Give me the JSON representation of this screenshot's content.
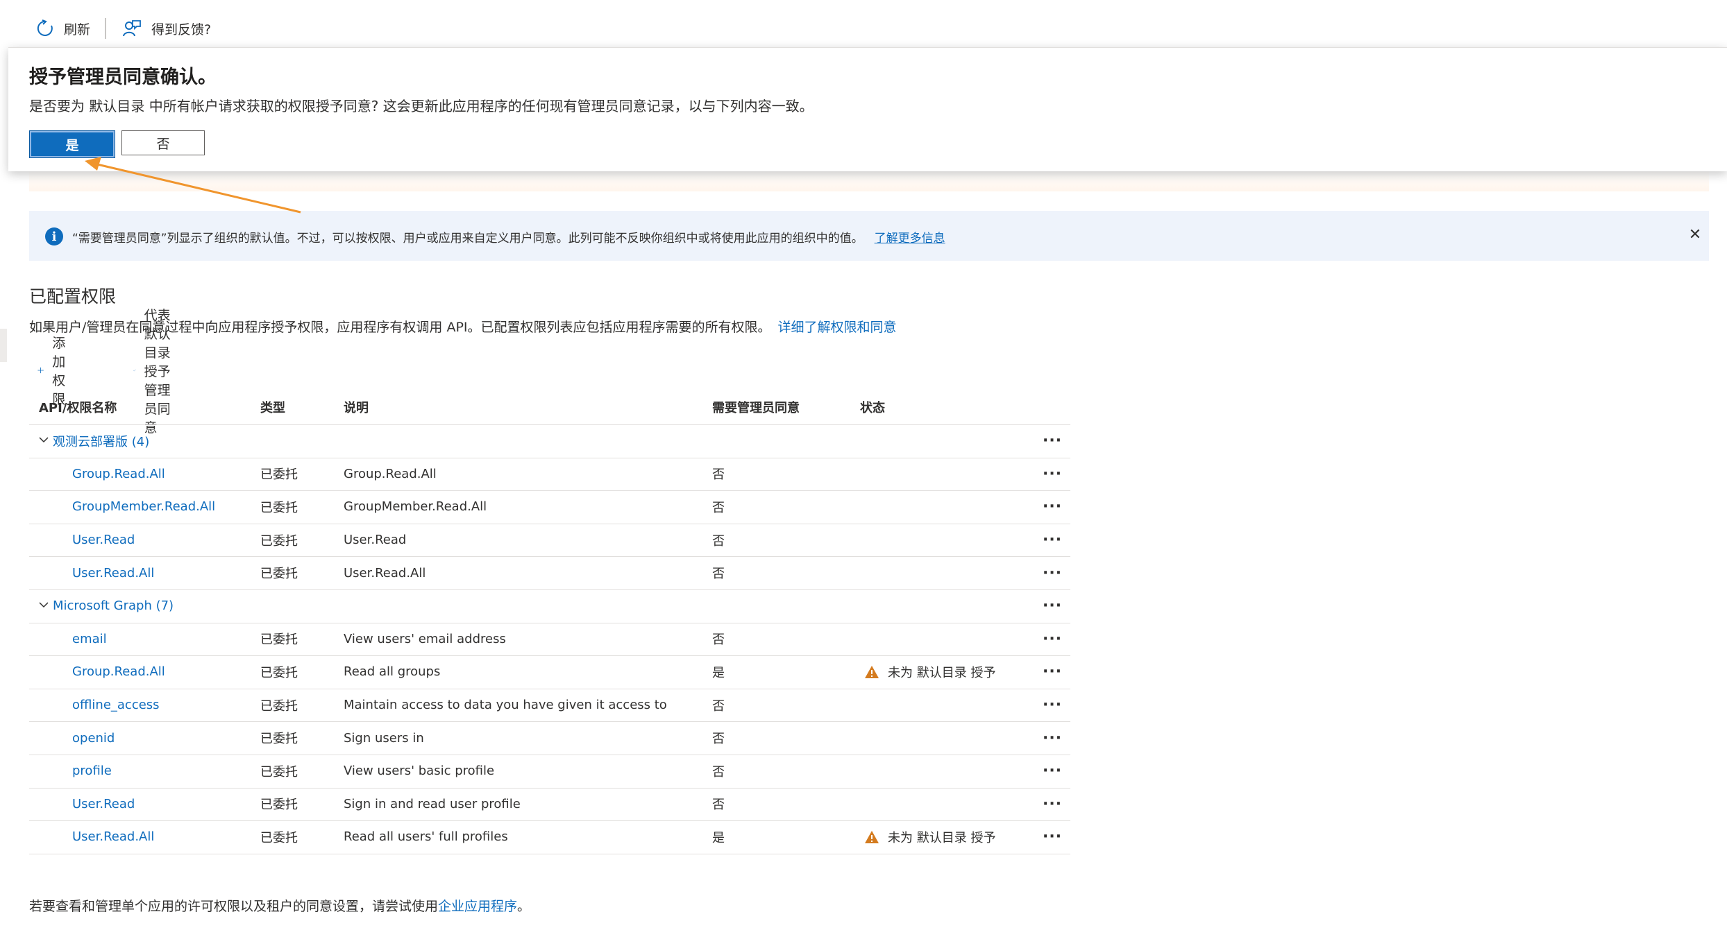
{
  "toolbar": {
    "refresh_label": "刷新",
    "feedback_label": "得到反馈?"
  },
  "dialog": {
    "title": "授予管理员同意确认。",
    "message": "是否要为 默认目录 中所有帐户请求获取的权限授予同意? 这会更新此应用程序的任何现有管理员同意记录，以与下列内容一致。",
    "yes_label": "是",
    "no_label": "否"
  },
  "info_banner": {
    "text": "“需要管理员同意”列显示了组织的默认值。不过，可以按权限、用户或应用来自定义用户同意。此列可能不反映你组织中或将使用此应用的组织中的值。",
    "link": "了解更多信息"
  },
  "section": {
    "title": "已配置权限",
    "description": "如果用户/管理员在同意过程中向应用程序授予权限，应用程序有权调用 API。已配置权限列表应包括应用程序需要的所有权限。",
    "link": "详细了解权限和同意"
  },
  "actions": {
    "add_permission": "添加权限",
    "grant_consent": "代表 默认目录 授予管理员同意"
  },
  "table": {
    "headers": {
      "name": "API/权限名称",
      "type": "类型",
      "description": "说明",
      "admin_consent": "需要管理员同意",
      "status": "状态"
    },
    "more_glyph": "···",
    "groups": [
      {
        "label": "观测云部署版 (4)",
        "rows": [
          {
            "name": "Group.Read.All",
            "type": "已委托",
            "description": "Group.Read.All",
            "admin": "否",
            "status": ""
          },
          {
            "name": "GroupMember.Read.All",
            "type": "已委托",
            "description": "GroupMember.Read.All",
            "admin": "否",
            "status": ""
          },
          {
            "name": "User.Read",
            "type": "已委托",
            "description": "User.Read",
            "admin": "否",
            "status": ""
          },
          {
            "name": "User.Read.All",
            "type": "已委托",
            "description": "User.Read.All",
            "admin": "否",
            "status": ""
          }
        ]
      },
      {
        "label": "Microsoft Graph (7)",
        "rows": [
          {
            "name": "email",
            "type": "已委托",
            "description": "View users' email address",
            "admin": "否",
            "status": ""
          },
          {
            "name": "Group.Read.All",
            "type": "已委托",
            "description": "Read all groups",
            "admin": "是",
            "status": "未为 默认目录 授予"
          },
          {
            "name": "offline_access",
            "type": "已委托",
            "description": "Maintain access to data you have given it access to",
            "admin": "否",
            "status": ""
          },
          {
            "name": "openid",
            "type": "已委托",
            "description": "Sign users in",
            "admin": "否",
            "status": ""
          },
          {
            "name": "profile",
            "type": "已委托",
            "description": "View users' basic profile",
            "admin": "否",
            "status": ""
          },
          {
            "name": "User.Read",
            "type": "已委托",
            "description": "Sign in and read user profile",
            "admin": "否",
            "status": ""
          },
          {
            "name": "User.Read.All",
            "type": "已委托",
            "description": "Read all users' full profiles",
            "admin": "是",
            "status": "未为 默认目录 授予"
          }
        ]
      }
    ]
  },
  "footer": {
    "text": "若要查看和管理单个应用的许可权限以及租户的同意设置，请尝试使用",
    "link": "企业应用程序",
    "suffix": "。"
  },
  "colors": {
    "accent": "#0f6cbd",
    "warning": "#d47b1f",
    "annotation_arrow": "#f0952d",
    "info_bg": "#eef3fb"
  }
}
